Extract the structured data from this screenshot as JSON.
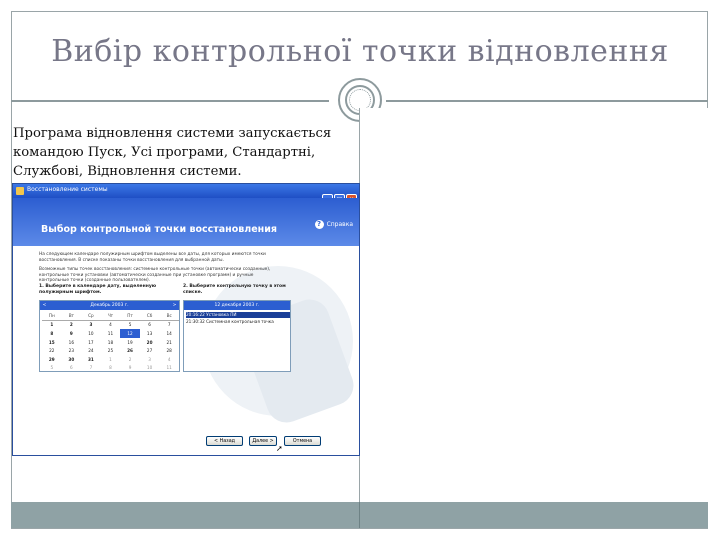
{
  "slide": {
    "title": "Вибір контрольної точки відновлення",
    "body_text": "Програма відновлення системи запускається командою Пуск, Усі програми, Стандартні, Службові, Відновлення системи."
  },
  "window": {
    "titlebar": "Восстановление системы",
    "header": "Выбор контрольной точки восстановления",
    "help": "Справка",
    "intro_1": "На следующем календаре полужирным шрифтом выделены все даты, для которых имеются точки восстановления. В списке показаны точки восстановления для выбранной даты.",
    "intro_2": "Возможные типы точек восстановления: системные контрольные точки (автоматически созданные), контрольные точки установки (автоматически созданные при установке программ) и ручные контрольные точки (созданные пользователем).",
    "step1": "1. Выберите в календаре дату, выделенную полужирным шрифтом.",
    "step2": "2. Выберите контрольную точку в этом списке.",
    "calendar": {
      "month": "Декабрь 2003 г.",
      "prev": "<",
      "next": ">",
      "days_of_week": [
        "Пн",
        "Вт",
        "Ср",
        "Чт",
        "Пт",
        "Сб",
        "Вс"
      ],
      "weeks": [
        [
          "1",
          "2",
          "3",
          "4",
          "5",
          "6",
          "7"
        ],
        [
          "8",
          "9",
          "10",
          "11",
          "12",
          "13",
          "14"
        ],
        [
          "15",
          "16",
          "17",
          "18",
          "19",
          "20",
          "21"
        ],
        [
          "22",
          "23",
          "24",
          "25",
          "26",
          "27",
          "28"
        ],
        [
          "29",
          "30",
          "31",
          "1",
          "2",
          "3",
          "4"
        ],
        [
          "5",
          "6",
          "7",
          "8",
          "9",
          "10",
          "11"
        ]
      ]
    },
    "points": {
      "date": "12 декабря 2003 г.",
      "items": [
        "20:16:22 Установка ПИ",
        "21:30:32 Системная контрольная точка"
      ]
    },
    "buttons": {
      "back": "< Назад",
      "next": "Далее >",
      "cancel": "Отмена"
    }
  }
}
